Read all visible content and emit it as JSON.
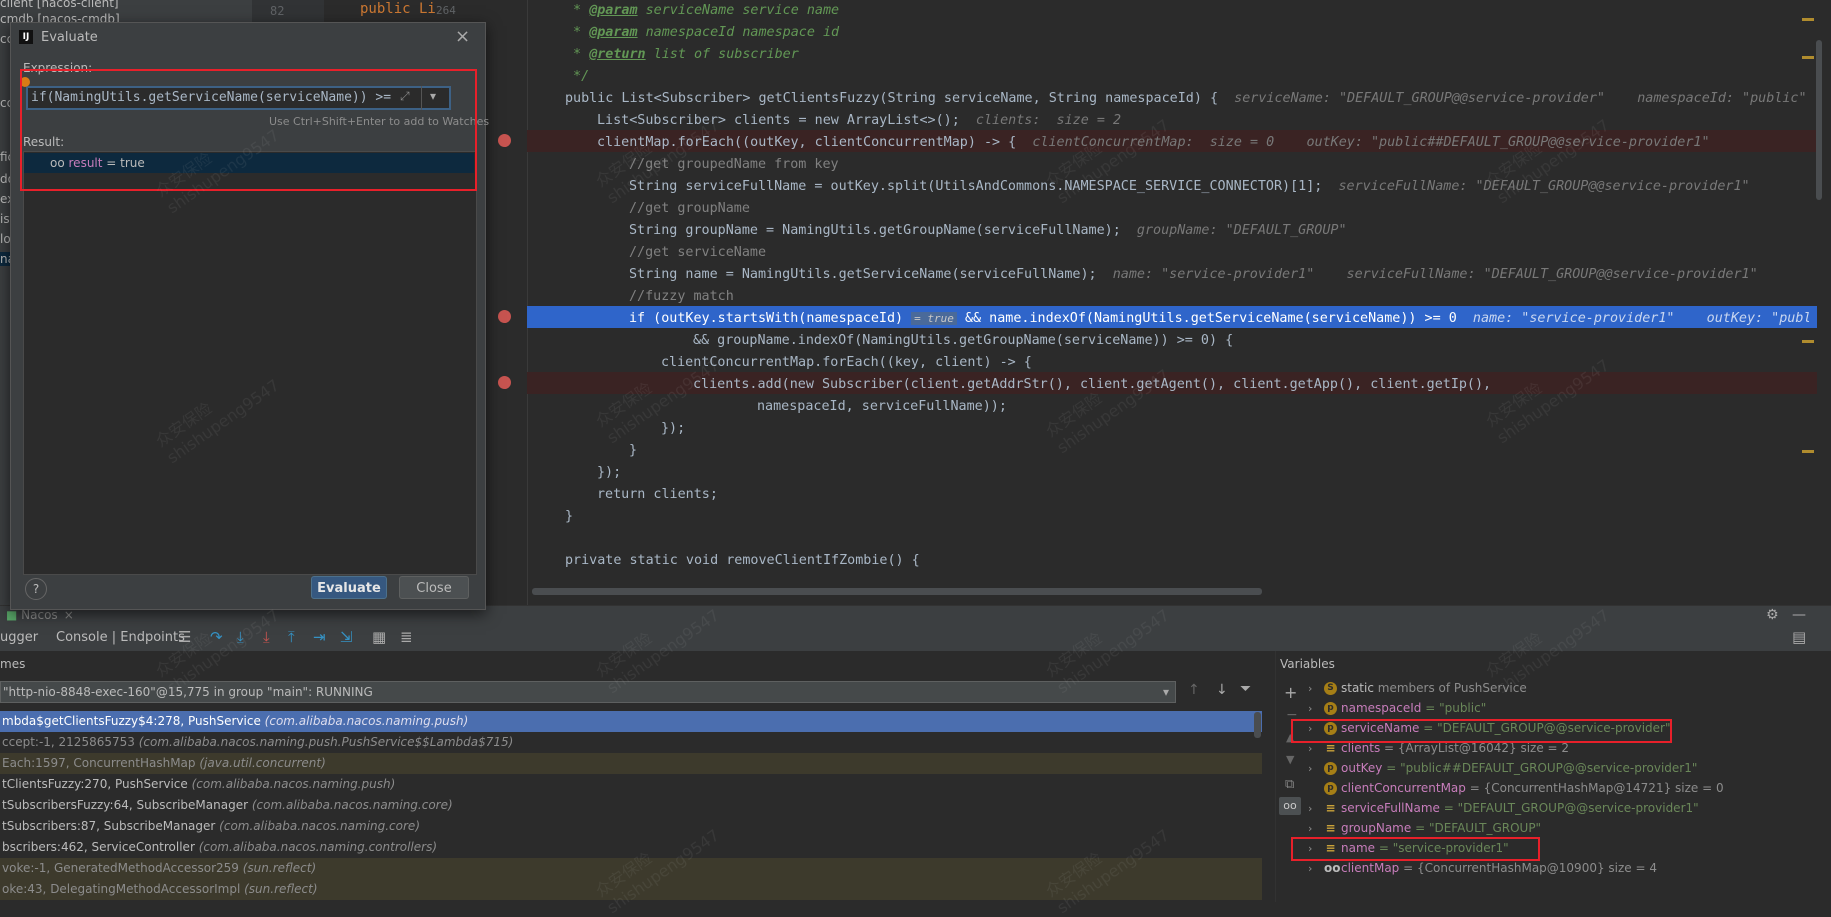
{
  "project_tree": [
    "client [nacos-client]",
    "cmdb [nacos-cmdb]",
    "cc",
    "cc",
    "cc",
    "cc",
    "fic",
    "do",
    "ex",
    "ist",
    "lo",
    "na"
  ],
  "editor": {
    "line_numbers": [
      "82",
      "264"
    ],
    "gutter_snippet": "public Li",
    "lines": {
      "l1_tag": "@param",
      "l1_rest": " serviceName service name",
      "l2_tag": "@param",
      "l2_rest": " namespaceId namespace id",
      "l3_tag": "@return",
      "l3_rest": " list of subscriber",
      "l4": " */",
      "sig": "public List<Subscriber> getClientsFuzzy(String serviceName, String namespaceId) {",
      "sig_hint": "serviceName: \"DEFAULT_GROUP@@service-provider\"    namespaceId: \"public\"",
      "l6": "List<Subscriber> clients = new ArrayList<>();",
      "l6_hint": "clients:  size = 2",
      "l7": "clientMap.forEach((outKey, clientConcurrentMap) -> {",
      "l7_hint": "clientConcurrentMap:  size = 0    outKey: \"public##DEFAULT_GROUP@@service-provider1\"",
      "l8": "//get groupedName from key",
      "l9": "String serviceFullName = outKey.split(UtilsAndCommons.NAMESPACE_SERVICE_CONNECTOR)[1];",
      "l9_hint": "serviceFullName: \"DEFAULT_GROUP@@service-provider1\"",
      "l10": "//get groupName",
      "l11": "String groupName = NamingUtils.getGroupName(serviceFullName);",
      "l11_hint": "groupName: \"DEFAULT_GROUP\"",
      "l12": "//get serviceName",
      "l13": "String name = NamingUtils.getServiceName(serviceFullName);",
      "l13_hint": "name: \"service-provider1\"    serviceFullName: \"DEFAULT_GROUP@@service-provider1\"",
      "l14": "//fuzzy match",
      "l15": "if (outKey.startsWith(namespaceId)",
      "l15_true": "= true",
      "l15_rest": "&& name.indexOf(NamingUtils.getServiceName(serviceName)) >= 0",
      "l15_hint": "name: \"service-provider1\"    outKey: \"public##",
      "l16": "&& groupName.indexOf(NamingUtils.getGroupName(serviceName)) >= 0) {",
      "l17": "clientConcurrentMap.forEach((key, client) -> {",
      "l18": "clients.add(new Subscriber(client.getAddrStr(), client.getAgent(), client.getApp(), client.getIp(),",
      "l19": "namespaceId, serviceFullName));",
      "l20": "});",
      "l21": "}",
      "l22": "});",
      "l23": "return clients;",
      "l24": "}",
      "l25": "private static void removeClientIfZombie() {"
    }
  },
  "evaluate_dialog": {
    "title": "Evaluate",
    "expression_label": "Expression:",
    "expression": "if(NamingUtils.getServiceName(serviceName)) >= 0",
    "hint": "Use Ctrl+Shift+Enter to add to Watches",
    "result_label": "Result:",
    "result_name": "result",
    "result_value": " = true",
    "evaluate_button": "Evaluate",
    "close_button": "Close",
    "help": "?"
  },
  "debug": {
    "run_tab": "Nacos",
    "debugger_tab": "ugger",
    "console_tab": "Console | Endpoints",
    "frames_header": "mes",
    "variables_header": "Variables",
    "thread": "\"http-nio-8848-exec-160\"@15,775 in group \"main\": RUNNING",
    "frames": [
      {
        "m": "mbda$getClientsFuzzy$4:278, PushService ",
        "p": "(com.alibaba.nacos.naming.push)"
      },
      {
        "m": "ccept:-1, 2125865753 ",
        "p": "(com.alibaba.nacos.naming.push.PushService$$Lambda$715)"
      },
      {
        "m": "Each:1597, ConcurrentHashMap ",
        "p": "(java.util.concurrent)"
      },
      {
        "m": "tClientsFuzzy:270, PushService ",
        "p": "(com.alibaba.nacos.naming.push)"
      },
      {
        "m": "tSubscribersFuzzy:64, SubscribeManager ",
        "p": "(com.alibaba.nacos.naming.core)"
      },
      {
        "m": "tSubscribers:87, SubscribeManager ",
        "p": "(com.alibaba.nacos.naming.core)"
      },
      {
        "m": "bscribers:462, ServiceController ",
        "p": "(com.alibaba.nacos.naming.controllers)"
      },
      {
        "m": "voke:-1, GeneratedMethodAccessor259 ",
        "p": "(sun.reflect)"
      },
      {
        "m": "oke:43, DelegatingMethodAccessorImpl ",
        "p": "(sun.reflect)"
      }
    ],
    "variables": [
      {
        "icon": "S",
        "name": "static",
        "value": " members of PushService"
      },
      {
        "icon": "p",
        "name": "namespaceId",
        "value": " = \"public\""
      },
      {
        "icon": "p",
        "name": "serviceName",
        "value": " = \"DEFAULT_GROUP@@service-provider\""
      },
      {
        "icon": "≡",
        "name": "clients",
        "value": " = {ArrayList@16042}  size = 2"
      },
      {
        "icon": "p",
        "name": "outKey",
        "value": " = \"public##DEFAULT_GROUP@@service-provider1\""
      },
      {
        "icon": "p",
        "name": "clientConcurrentMap",
        "value": " = {ConcurrentHashMap@14721}  size = 0"
      },
      {
        "icon": "≡",
        "name": "serviceFullName",
        "value": " = \"DEFAULT_GROUP@@service-provider1\""
      },
      {
        "icon": "≡",
        "name": "groupName",
        "value": " = \"DEFAULT_GROUP\""
      },
      {
        "icon": "≡",
        "name": "name",
        "value": " = \"service-provider1\""
      },
      {
        "icon": "oo",
        "name": "clientMap",
        "value": " = {ConcurrentHashMap@10900}  size = 4"
      }
    ]
  },
  "watermark": [
    "众安保险",
    "shishupeng9547"
  ],
  "colors": {
    "highlight": "#2f65ca",
    "breakpoint": "#c75450",
    "selection": "#0d293e",
    "annotation_box": "#e8202a"
  }
}
